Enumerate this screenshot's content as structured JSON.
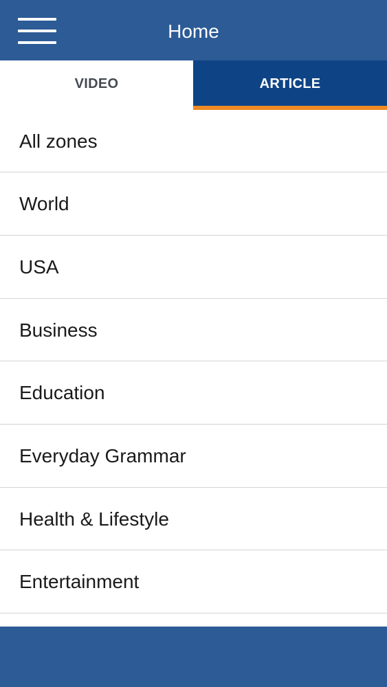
{
  "header": {
    "title": "Home",
    "menu_icon": "hamburger-menu-icon",
    "background_color": "#2c5b96"
  },
  "tabs": [
    {
      "label": "VIDEO",
      "selected": false
    },
    {
      "label": "ARTICLE",
      "selected": true
    }
  ],
  "colors": {
    "tab_active_bg": "#0e4485",
    "tab_active_underline": "#f08a24"
  },
  "zones": [
    {
      "label": "All zones"
    },
    {
      "label": "World"
    },
    {
      "label": "USA"
    },
    {
      "label": "Business"
    },
    {
      "label": "Education"
    },
    {
      "label": "Everyday Grammar"
    },
    {
      "label": "Health & Lifestyle"
    },
    {
      "label": "Entertainment"
    }
  ]
}
